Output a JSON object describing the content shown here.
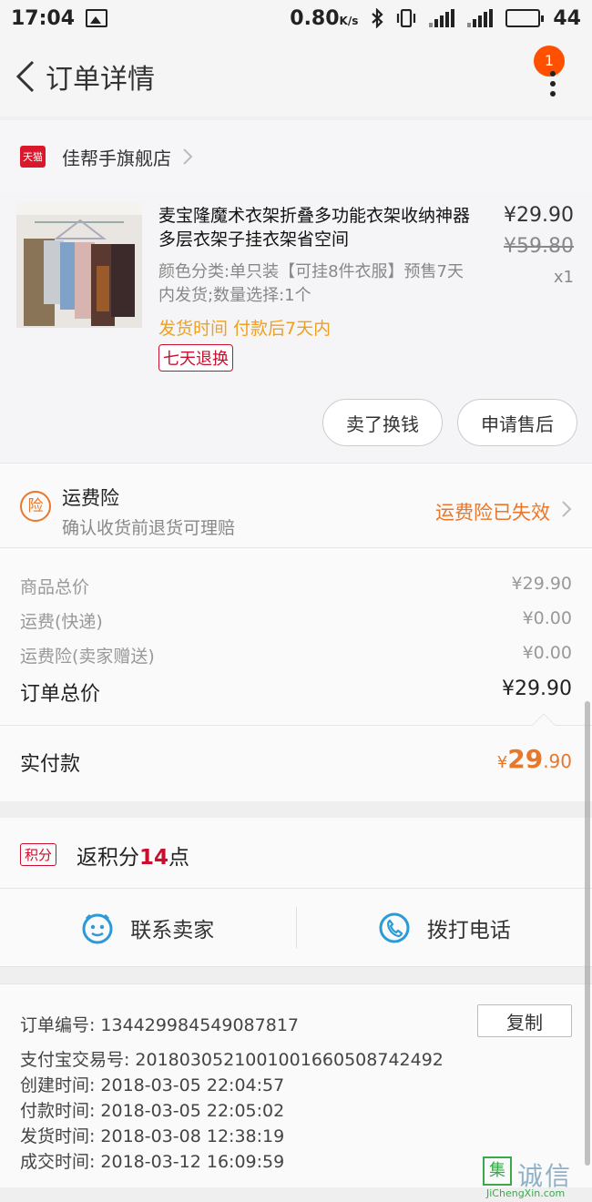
{
  "status_bar": {
    "time": "17:04",
    "net_speed": "0.80",
    "net_unit": "K/s",
    "battery": "44",
    "battery_level": 0.44
  },
  "nav": {
    "title": "订单详情",
    "badge": "1"
  },
  "shop": {
    "name": "佳帮手旗舰店",
    "platform_label": "天猫"
  },
  "product": {
    "title": "麦宝隆魔术衣架折叠多功能衣架收纳神器多层衣架子挂衣架省空间",
    "sku": "颜色分类:单只装【可挂8件衣服】预售7天内发货;数量选择:1个",
    "ship_time": "发货时间 付款后7天内",
    "tag": "七天退换",
    "price": "¥29.90",
    "original_price": "¥59.80",
    "quantity": "x1",
    "buttons": {
      "sell": "卖了换钱",
      "after_sale": "申请售后"
    }
  },
  "insurance": {
    "icon_char": "险",
    "title": "运费险",
    "subtitle": "确认收货前退货可理赔",
    "status": "运费险已失效"
  },
  "prices": {
    "rows": [
      {
        "label": "商品总价",
        "value": "¥29.90"
      },
      {
        "label": "运费(快递)",
        "value": "¥0.00"
      },
      {
        "label": "运费险(卖家赠送)",
        "value": "¥0.00"
      }
    ],
    "total_label": "订单总价",
    "total_value": "¥29.90",
    "paid_label": "实付款",
    "paid_currency": "¥",
    "paid_int": "29",
    "paid_dec": ".90"
  },
  "points": {
    "tag": "积分",
    "text_prefix": "返积分",
    "amount": "14",
    "text_suffix": "点"
  },
  "contact": {
    "seller": "联系卖家",
    "phone": "拨打电话"
  },
  "order_info": {
    "copy_label": "复制",
    "rows": [
      {
        "label": "订单编号:",
        "value": "134429984549087817"
      },
      {
        "label": "支付宝交易号:",
        "value": "2018030521001001660508742492"
      },
      {
        "label": "创建时间:",
        "value": "2018-03-05 22:04:57"
      },
      {
        "label": "付款时间:",
        "value": "2018-03-05 22:05:02"
      },
      {
        "label": "发货时间:",
        "value": "2018-03-08 12:38:19"
      },
      {
        "label": "成交时间:",
        "value": "2018-03-12 16:09:59"
      }
    ]
  },
  "watermark": {
    "logo": "集",
    "text": "诚信",
    "sub": "JiChengXin.com"
  },
  "colors": {
    "accent_orange": "#e8772a",
    "tmall_red": "#d9182b",
    "badge": "#ff5000",
    "contact_blue": "#2a9ad8"
  }
}
